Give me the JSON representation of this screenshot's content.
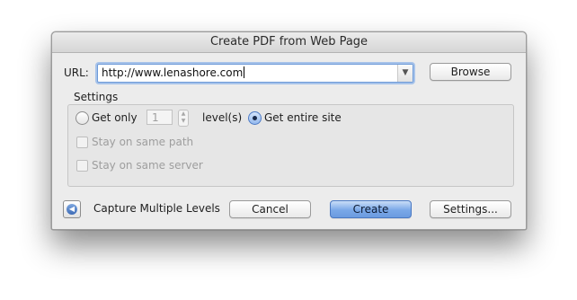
{
  "dialog": {
    "title": "Create PDF from Web Page"
  },
  "url": {
    "label": "URL:",
    "value": "http://www.lenashore.com"
  },
  "buttons": {
    "browse": "Browse",
    "cancel": "Cancel",
    "create": "Create",
    "settings": "Settings..."
  },
  "settings_group": {
    "label": "Settings",
    "get_only": "Get only",
    "levels_value": "1",
    "levels_label": "level(s)",
    "get_entire_site": "Get entire site",
    "selected_option": "get_entire_site",
    "stay_same_path": "Stay on same path",
    "stay_same_server": "Stay on same server"
  },
  "capture": {
    "label": "Capture Multiple Levels"
  },
  "icons": {
    "dropdown": "chevron-down-icon",
    "stepper": "stepper-arrows-icon",
    "capture": "disclosure-left-icon"
  },
  "colors": {
    "default_button": "#6b9be0",
    "focus_ring": "#a7c3ea"
  }
}
